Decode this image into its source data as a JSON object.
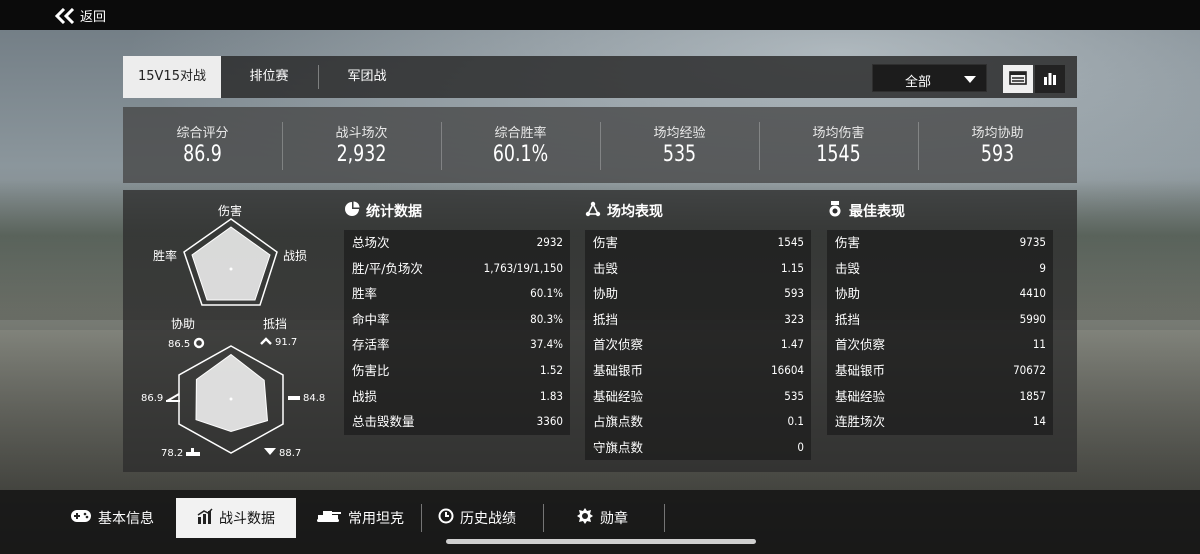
{
  "nav": {
    "back_label": "返回"
  },
  "tabs": [
    {
      "label": "15V15对战",
      "active": true
    },
    {
      "label": "排位赛",
      "active": false
    },
    {
      "label": "军团战",
      "active": false
    }
  ],
  "filter": {
    "selected": "全部"
  },
  "summary": [
    {
      "label": "综合评分",
      "value": "86.9"
    },
    {
      "label": "战斗场次",
      "value": "2,932"
    },
    {
      "label": "综合胜率",
      "value": "60.1%"
    },
    {
      "label": "场均经验",
      "value": "535"
    },
    {
      "label": "场均伤害",
      "value": "1545"
    },
    {
      "label": "场均协助",
      "value": "593"
    }
  ],
  "radar_top": {
    "labels": [
      "伤害",
      "战损",
      "抵挡",
      "协助",
      "胜率"
    ]
  },
  "radar_bottom": {
    "values": [
      "91.7",
      "84.8",
      "88.7",
      "78.2",
      "86.9",
      "86.5"
    ],
    "levels": [
      0.917,
      0.848,
      0.887,
      0.782,
      0.869,
      0.865
    ]
  },
  "stats": {
    "title": "统计数据",
    "rows": [
      {
        "k": "总场次",
        "v": "2932"
      },
      {
        "k": "胜/平/负场次",
        "v": "1,763/19/1,150"
      },
      {
        "k": "胜率",
        "v": "60.1%"
      },
      {
        "k": "命中率",
        "v": "80.3%"
      },
      {
        "k": "存活率",
        "v": "37.4%"
      },
      {
        "k": "伤害比",
        "v": "1.52"
      },
      {
        "k": "战损",
        "v": "1.83"
      },
      {
        "k": "总击毁数量",
        "v": "3360"
      }
    ]
  },
  "avg": {
    "title": "场均表现",
    "rows": [
      {
        "k": "伤害",
        "v": "1545"
      },
      {
        "k": "击毁",
        "v": "1.15"
      },
      {
        "k": "协助",
        "v": "593"
      },
      {
        "k": "抵挡",
        "v": "323"
      },
      {
        "k": "首次侦察",
        "v": "1.47"
      },
      {
        "k": "基础银币",
        "v": "16604"
      },
      {
        "k": "基础经验",
        "v": "535"
      },
      {
        "k": "占旗点数",
        "v": "0.1"
      },
      {
        "k": "守旗点数",
        "v": "0"
      }
    ]
  },
  "best": {
    "title": "最佳表现",
    "rows": [
      {
        "k": "伤害",
        "v": "9735"
      },
      {
        "k": "击毁",
        "v": "9"
      },
      {
        "k": "协助",
        "v": "4410"
      },
      {
        "k": "抵挡",
        "v": "5990"
      },
      {
        "k": "首次侦察",
        "v": "11"
      },
      {
        "k": "基础银币",
        "v": "70672"
      },
      {
        "k": "基础经验",
        "v": "1857"
      },
      {
        "k": "连胜场次",
        "v": "14"
      }
    ]
  },
  "bottom_tabs": [
    {
      "label": "基本信息",
      "icon": "gamepad-icon",
      "active": false
    },
    {
      "label": "战斗数据",
      "icon": "bar-chart-icon",
      "active": true
    },
    {
      "label": "常用坦克",
      "icon": "tank-icon",
      "active": false
    },
    {
      "label": "历史战绩",
      "icon": "clock-icon",
      "active": false
    },
    {
      "label": "勋章",
      "icon": "medal-icon",
      "active": false
    }
  ],
  "colors": {
    "active_tab_bg": "#ededed",
    "panel_bg": "#2d2d2d"
  }
}
